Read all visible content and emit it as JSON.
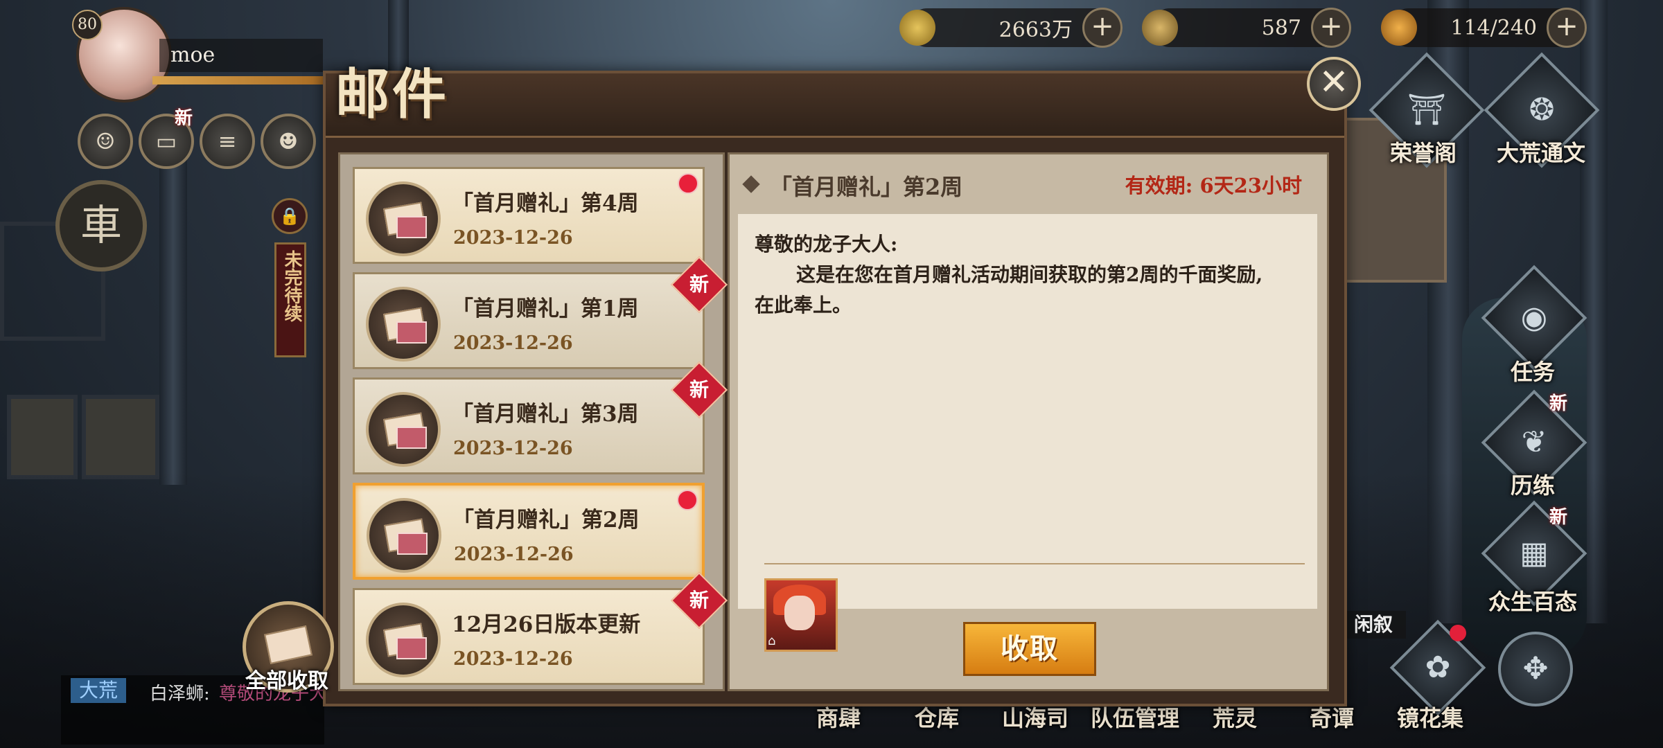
{
  "player": {
    "level": "80",
    "name": "moe"
  },
  "resources": [
    {
      "icon": "coin-icon",
      "value": "2663万"
    },
    {
      "icon": "jade-icon",
      "value": "587"
    },
    {
      "icon": "stamina-icon",
      "value": "114/240"
    }
  ],
  "left_buttons": {
    "new_label": "新",
    "side_text": "未完待续"
  },
  "mail": {
    "title": "邮件",
    "items": [
      {
        "title": "「首月赠礼」第4周",
        "date": "2023-12-26",
        "marker": "dot"
      },
      {
        "title": "「首月赠礼」第1周",
        "date": "2023-12-26",
        "marker": "新"
      },
      {
        "title": "「首月赠礼」第3周",
        "date": "2023-12-26",
        "marker": "新"
      },
      {
        "title": "「首月赠礼」第2周",
        "date": "2023-12-26",
        "marker": "dot"
      },
      {
        "title": "12月26日版本更新",
        "date": "2023-12-26",
        "marker": "新"
      }
    ],
    "detail": {
      "title": "「首月赠礼」第2周",
      "validity": "有效期: 6天23小时",
      "greeting": "尊敬的龙子大人:",
      "body_line1": "这是在您在首月赠礼活动期间获取的第2周的千面奖励,",
      "body_line2": "在此奉上。",
      "claim_label": "收取"
    },
    "claim_all_label": "全部收取"
  },
  "right_menu": [
    {
      "label": "荣誉阁",
      "icon": "honor-hall-icon"
    },
    {
      "label": "大荒通文",
      "icon": "scroll-icon"
    },
    {
      "label": "任务",
      "icon": "quest-icon"
    },
    {
      "label": "历练",
      "icon": "training-icon",
      "new": "新"
    },
    {
      "label": "众生百态",
      "icon": "cards-icon",
      "new": "新"
    }
  ],
  "chat": {
    "channel": "大荒",
    "speaker": "白泽蛳:",
    "message": "尊敬的龙子大人"
  },
  "bottom_nav": [
    "商肆",
    "仓库",
    "山海司",
    "队伍管理",
    "荒灵",
    "奇谭",
    "镜花集"
  ],
  "side_tag": "闲叙"
}
